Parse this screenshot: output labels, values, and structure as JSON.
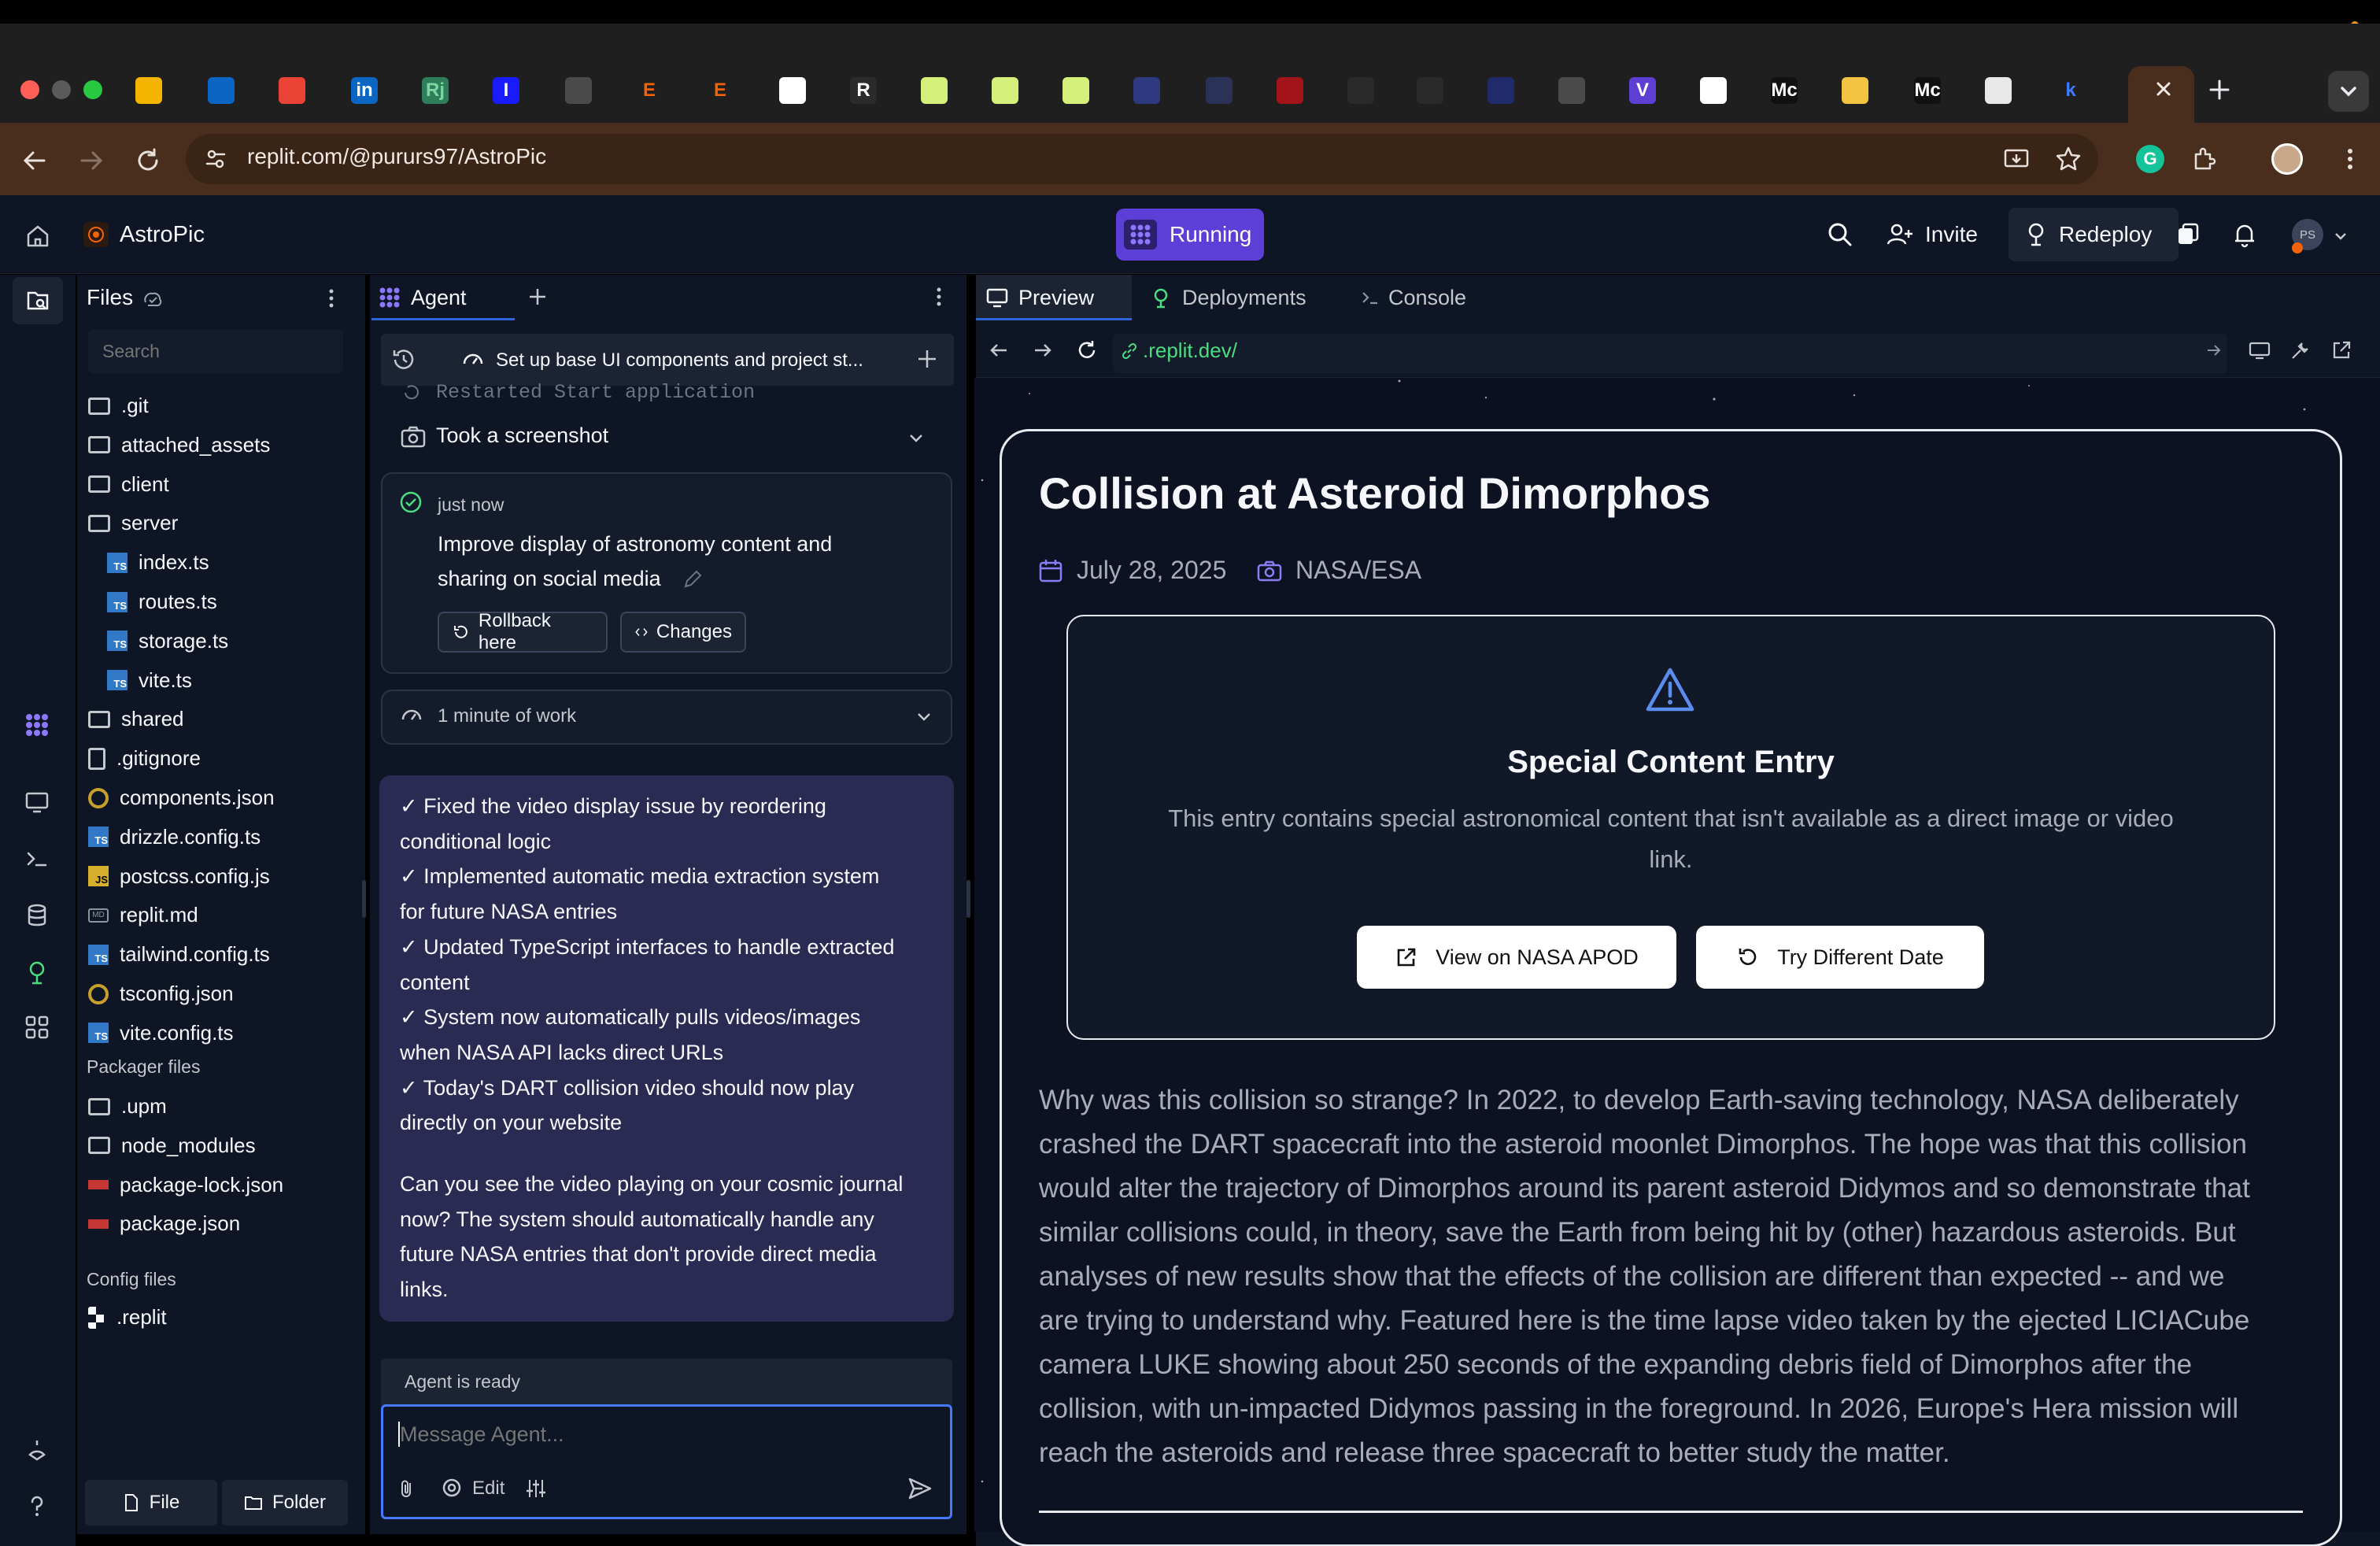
{
  "browser": {
    "tab_icons": [
      "google-drive-icon",
      "outlook-icon",
      "gmail-icon",
      "linkedin-icon",
      "rj-icon",
      "i-icon",
      "globe-icon",
      "e-icon",
      "e-icon-2",
      "docs-icon",
      "r-icon",
      "green-square-icon",
      "green-square-icon-2",
      "green-square-icon-3",
      "shield-icon",
      "shield-icon-2",
      "red-dot-icon",
      "dark-icon",
      "binary-icon",
      "c-icon",
      "globe-icon-2",
      "vc-icon",
      "notes-icon",
      "medium-icon",
      "chrome-icon",
      "medium-icon-2",
      "stripes-icon",
      "k-icon"
    ],
    "tab_letters": {
      "rj-icon": "Rj",
      "i-icon": "I",
      "e-icon": "E",
      "e-icon-2": "E",
      "r-icon": "R",
      "vc-icon": "V",
      "medium-icon": "Mc",
      "medium-icon-2": "Mc",
      "k-icon": "k",
      "linkedin-icon": "in"
    },
    "url": "replit.com/@pururs97/AstroPic"
  },
  "header": {
    "app_name": "AstroPic",
    "run_label": "Running",
    "invite_label": "Invite",
    "redeploy_label": "Redeploy",
    "avatar_initials": "PS"
  },
  "files": {
    "title": "Files",
    "search_placeholder": "Search",
    "items": [
      {
        "name": ".git",
        "type": "folder"
      },
      {
        "name": "attached_assets",
        "type": "folder"
      },
      {
        "name": "client",
        "type": "folder"
      },
      {
        "name": "server",
        "type": "folder"
      },
      {
        "name": "index.ts",
        "type": "ts"
      },
      {
        "name": "routes.ts",
        "type": "ts"
      },
      {
        "name": "storage.ts",
        "type": "ts"
      },
      {
        "name": "vite.ts",
        "type": "ts"
      },
      {
        "name": "shared",
        "type": "folder"
      },
      {
        "name": ".gitignore",
        "type": "file"
      },
      {
        "name": "components.json",
        "type": "json"
      },
      {
        "name": "drizzle.config.ts",
        "type": "ts"
      },
      {
        "name": "postcss.config.js",
        "type": "js"
      },
      {
        "name": "replit.md",
        "type": "md"
      },
      {
        "name": "tailwind.config.ts",
        "type": "ts"
      },
      {
        "name": "tsconfig.json",
        "type": "json"
      },
      {
        "name": "vite.config.ts",
        "type": "ts"
      }
    ],
    "packager_label": "Packager files",
    "packager_items": [
      {
        "name": ".upm",
        "type": "folder"
      },
      {
        "name": "node_modules",
        "type": "folder"
      },
      {
        "name": "package-lock.json",
        "type": "npm"
      },
      {
        "name": "package.json",
        "type": "npm"
      }
    ],
    "config_label": "Config files",
    "config_items": [
      {
        "name": ".replit",
        "type": "replit"
      }
    ],
    "new_file_label": "File",
    "new_folder_label": "Folder"
  },
  "agent": {
    "tab_label": "Agent",
    "thread_title": "Set up base UI components and project st...",
    "restarted_text": "Restarted Start application",
    "screenshot_text": "Took a screenshot",
    "checkpoint_time": "just now",
    "checkpoint_message_1": "Improve display of astronomy content and",
    "checkpoint_message_2": "sharing on social media",
    "rollback_label": "Rollback here",
    "changes_label": "Changes",
    "work_label": "1 minute of work",
    "summary_lines": [
      "✓ Fixed the video display issue by reordering",
      "conditional logic",
      "✓ Implemented automatic media extraction system",
      "for future NASA entries",
      "✓ Updated TypeScript interfaces to handle extracted",
      "content",
      "✓ System now automatically pulls videos/images",
      "when NASA API lacks direct URLs",
      "✓ Today's DART collision video should now play",
      "directly on your website"
    ],
    "question_lines": [
      "Can you see the video playing on your cosmic journal",
      "now? The system should automatically handle any",
      "future NASA entries that don't provide direct media",
      "links."
    ],
    "status": "Agent is ready",
    "input_placeholder": "Message Agent...",
    "edit_label": "Edit"
  },
  "preview": {
    "tabs": {
      "preview": "Preview",
      "deployments": "Deployments",
      "console": "Console"
    },
    "url": ".replit.dev/"
  },
  "page": {
    "title": "Collision at Asteroid Dimorphos",
    "date": "July 28, 2025",
    "credit": "NASA/ESA",
    "special_title": "Special Content Entry",
    "special_line_1": "This entry contains special astronomical content that isn't available as a direct image or video",
    "special_line_2": "link.",
    "view_button": "View on NASA APOD",
    "try_button": "Try Different Date",
    "description_lines": [
      "Why was this collision so strange? In 2022, to develop Earth-saving technology, NASA deliberately",
      "crashed the DART spacecraft into the asteroid moonlet Dimorphos. The hope was that this collision",
      "would alter the trajectory of Dimorphos around its parent asteroid Didymos and so demonstrate that",
      "similar collisions could, in theory, save the Earth from being hit by (other) hazardous asteroids. But",
      "analyses of new results show that the effects of the collision are different than expected -- and we",
      "are trying to understand why. Featured here is the time lapse video taken by the ejected LICIACube",
      "camera LUKE showing about 250 seconds of the expanding debris field of Dimorphos after the",
      "collision, with un-impacted Didymos passing in the foreground. In 2026, Europe's Hera mission will",
      "reach the asteroids and release three spacecraft to better study the matter."
    ]
  },
  "colors": {
    "accent": "#5b3fd6",
    "chrome_toolbar": "#4a2e1d",
    "ide_bg": "#0e1525",
    "link_green": "#4ade80",
    "input_focus": "#4779ff"
  }
}
